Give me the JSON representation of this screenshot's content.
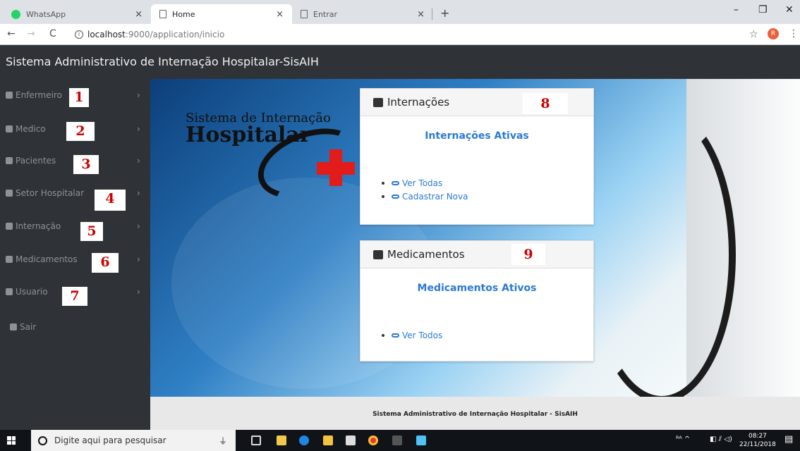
{
  "browser": {
    "tabs": [
      {
        "title": "WhatsApp",
        "icon": "whatsapp-icon"
      },
      {
        "title": "Home",
        "icon": "page-icon"
      },
      {
        "title": "Entrar",
        "icon": "page-icon"
      }
    ],
    "tab_close": "×",
    "new_tab": "+",
    "window_controls": {
      "minimize": "–",
      "restore": "❐",
      "close": "✕"
    },
    "nav": {
      "back": "←",
      "forward": "→",
      "reload": "C"
    },
    "url_host": "localhost",
    "url_path": ":9000/application/inicio",
    "star": "☆",
    "profile_initial": "R",
    "menu": "⋮"
  },
  "app": {
    "title": "Sistema Administrativo de Internação Hospitalar-SisAIH"
  },
  "sidebar": {
    "items": [
      {
        "label": "Enfermeiro",
        "marker": "1"
      },
      {
        "label": "Medico",
        "marker": "2"
      },
      {
        "label": "Pacientes",
        "marker": "3"
      },
      {
        "label": "Setor Hospitalar",
        "marker": "4"
      },
      {
        "label": "Internação",
        "marker": "5"
      },
      {
        "label": "Medicamentos",
        "marker": "6"
      },
      {
        "label": "Usuario",
        "marker": "7"
      }
    ],
    "chevron": "›",
    "logout": "Sair"
  },
  "banner": {
    "logo_line1": "Sistema de Internação",
    "logo_line2": "Hospitalar"
  },
  "cards": [
    {
      "title": "Internações",
      "marker": "8",
      "subtitle": "Internações Ativas",
      "links": [
        "Ver Todas",
        "Cadastrar Nova"
      ]
    },
    {
      "title": "Medicamentos",
      "marker": "9",
      "subtitle": "Medicamentos Ativos",
      "links": [
        "Ver Todos"
      ]
    }
  ],
  "footer": {
    "text": "Sistema Administrativo de Internação Hospitalar - SisAIH"
  },
  "taskbar": {
    "search_placeholder": "Digite aqui para pesquisar",
    "tray_symbols": "ᴿᴬ  ^",
    "time": "08:27",
    "date": "22/11/2018"
  },
  "colors": {
    "sidebar_bg": "#2f3337",
    "link_blue": "#2a7ad2",
    "marker_red": "#cc0000",
    "cross_red": "#e21b1b"
  }
}
